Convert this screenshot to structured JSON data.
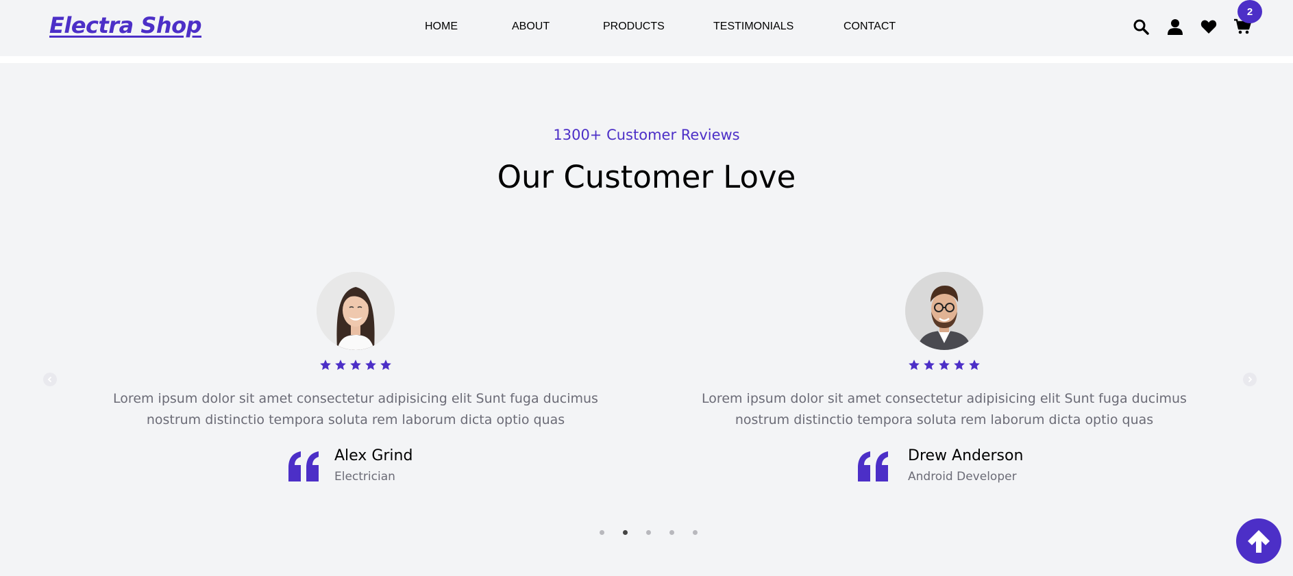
{
  "header": {
    "logo": "Electra Shop",
    "nav": [
      "HOME",
      "ABOUT",
      "PRODUCTS",
      "TESTIMONIALS",
      "CONTACT"
    ],
    "cart_count": "2",
    "icons": [
      "search-icon",
      "user-icon",
      "heart-icon",
      "cart-icon"
    ]
  },
  "section": {
    "subtitle": "1300+ Customer Reviews",
    "title": "Our Customer Love"
  },
  "testimonials": [
    {
      "rating": 5,
      "text": "Lorem ipsum dolor sit amet consectetur adipisicing elit Sunt fuga ducimus nostrum distinctio tempora soluta rem laborum dicta optio quas",
      "name": "Alex Grind",
      "role": "Electrician"
    },
    {
      "rating": 5,
      "text": "Lorem ipsum dolor sit amet consectetur adipisicing elit Sunt fuga ducimus nostrum distinctio tempora soluta rem laborum dicta optio quas",
      "name": "Drew Anderson",
      "role": "Android Developer"
    }
  ],
  "carousel": {
    "dot_count": 5,
    "active_dot": 2
  },
  "colors": {
    "accent": "#4c2fc7",
    "background": "#f3f4f6",
    "muted_text": "#6b6b76"
  }
}
